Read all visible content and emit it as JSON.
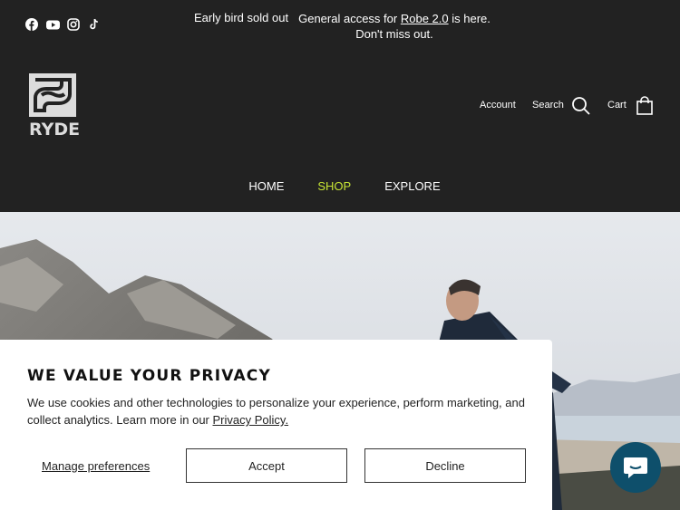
{
  "announcement": {
    "left": "Early bird sold out",
    "right_prefix": "General access for",
    "right_link": "Robe 2.0",
    "right_suffix": "is here. Don't miss out."
  },
  "social": [
    {
      "icon": "facebook-icon"
    },
    {
      "icon": "youtube-icon"
    },
    {
      "icon": "instagram-icon"
    },
    {
      "icon": "tiktok-icon"
    }
  ],
  "logo": {
    "text": "RYDE"
  },
  "header": {
    "account_label": "Account",
    "search_label": "Search",
    "cart_label": "Cart"
  },
  "nav": {
    "home": "HOME",
    "shop": "SHOP",
    "explore": "EXPLORE"
  },
  "cookie": {
    "title": "WE VALUE YOUR PRIVACY",
    "text": "We use cookies and other technologies to personalize your experience, perform marketing, and collect analytics. Learn more in our",
    "policy_link": "Privacy Policy.",
    "manage": "Manage preferences",
    "accept": "Accept",
    "decline": "Decline"
  },
  "colors": {
    "background": "#222222",
    "accent_shop": "#c8e635",
    "chat": "#0e4f6b"
  }
}
